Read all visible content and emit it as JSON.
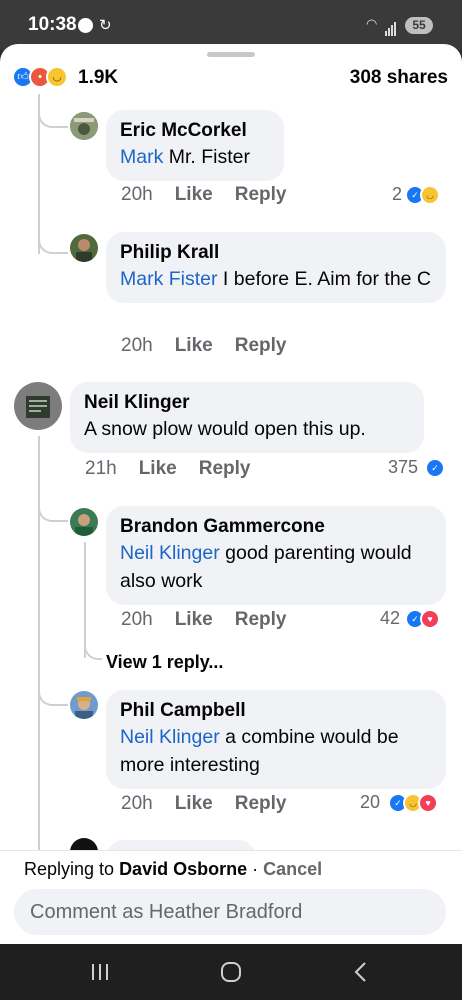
{
  "status": {
    "time": "10:38",
    "battery": "55"
  },
  "summary": {
    "reaction_count": "1.9K",
    "shares": "308 shares"
  },
  "comments": [
    {
      "author": "Eric McCorkel",
      "mention": "Mark",
      "text": " Mr. Fister",
      "time": "20h",
      "like": "Like",
      "reply": "Reply",
      "reactions": "2"
    },
    {
      "author": "Philip Krall",
      "mention": "Mark Fister",
      "text": " I before E. Aim for the C",
      "time": "20h",
      "like": "Like",
      "reply": "Reply"
    },
    {
      "author": "Neil Klinger",
      "text": "A snow plow would open this up.",
      "time": "21h",
      "like": "Like",
      "reply": "Reply",
      "reactions": "375"
    },
    {
      "author": "Brandon Gammercone",
      "mention": "Neil Klinger",
      "text": " good parenting would also work",
      "time": "20h",
      "like": "Like",
      "reply": "Reply",
      "reactions": "42",
      "view_replies": "View 1 reply..."
    },
    {
      "author": "Phil Campbell",
      "mention": "Neil Klinger",
      "text": " a combine would be more interesting",
      "time": "20h",
      "like": "Like",
      "reply": "Reply",
      "reactions": "20"
    }
  ],
  "reply_bar": {
    "prefix": "Replying to ",
    "name": "David Osborne",
    "separator": " · ",
    "cancel": "Cancel",
    "placeholder": "Comment as Heather Bradford"
  },
  "icons": {
    "reactions": [
      "like-icon",
      "angry-icon",
      "haha-icon",
      "love-icon"
    ],
    "nav": [
      "recent-apps-icon",
      "home-icon",
      "back-icon"
    ]
  },
  "colors": {
    "link": "#1b66c9",
    "like": "#1877f2",
    "bubble": "#f0f2f5"
  }
}
